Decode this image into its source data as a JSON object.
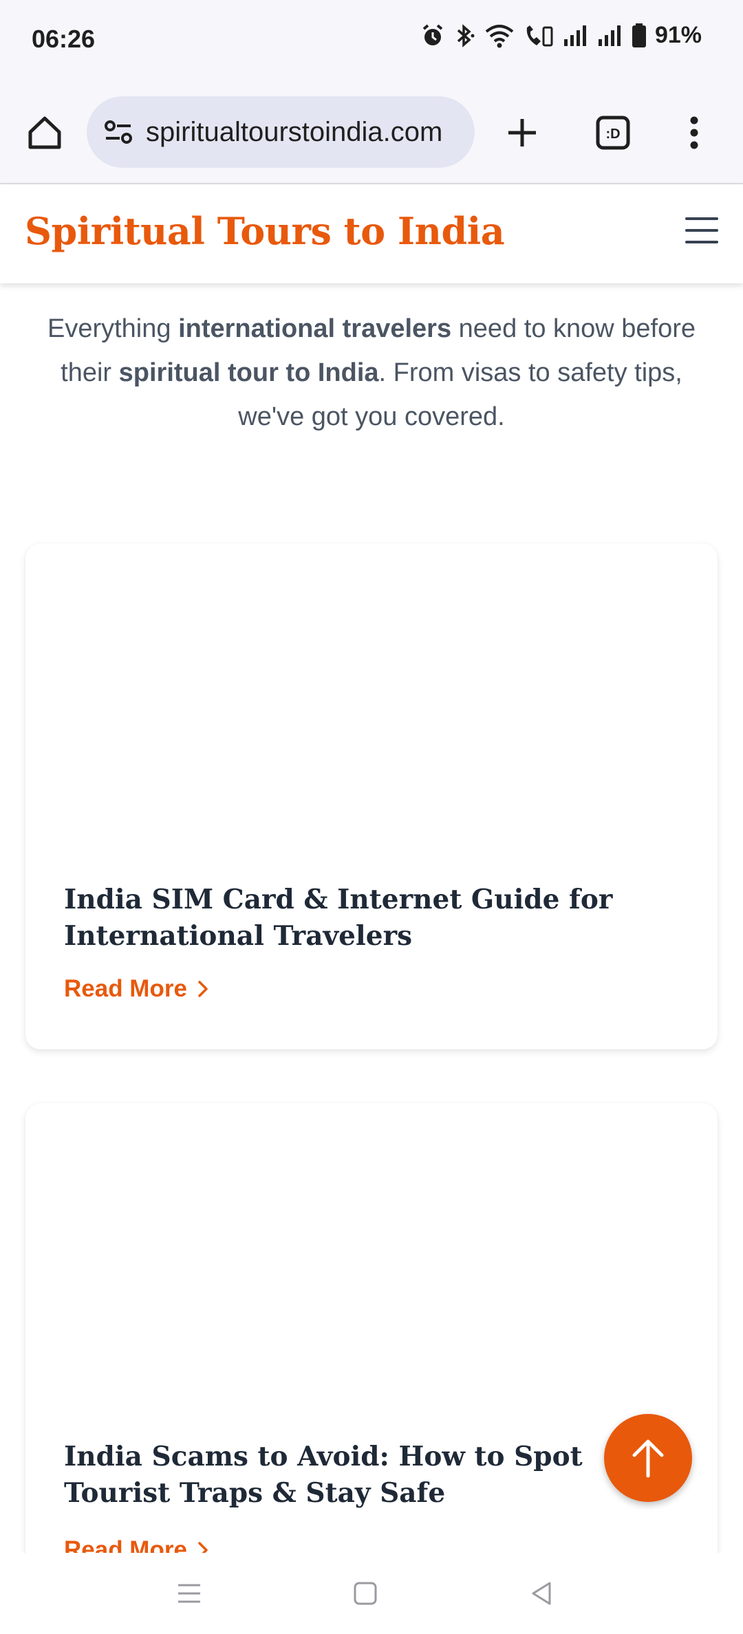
{
  "status_bar": {
    "time": "06:26",
    "battery_percent": "91%",
    "icons": [
      "alarm-icon",
      "bluetooth-icon",
      "wifi-icon",
      "wifi-calling-icon",
      "signal-icon",
      "signal-icon",
      "battery-icon"
    ]
  },
  "browser": {
    "url": "spiritualtourstoindia.com",
    "icons": [
      "home-icon",
      "site-info-icon",
      "new-tab-icon",
      "tab-switcher-icon",
      "more-vert-icon"
    ]
  },
  "site": {
    "title": "Spiritual Tours to India",
    "menu_icon": "hamburger-menu-icon"
  },
  "intro": {
    "part1": "Everything ",
    "bold1": "international travelers",
    "part2": " need to know before their ",
    "bold2": "spiritual tour to India",
    "part3": ". From visas to safety tips, we've got you covered."
  },
  "articles": [
    {
      "title": "India SIM Card & Internet Guide for International Travelers",
      "link": "Read More"
    },
    {
      "title": "India Scams to Avoid: How to Spot Tourist Traps & Stay Safe",
      "link": "Read More"
    }
  ],
  "fab": {
    "icon": "arrow-up-icon"
  },
  "nav": {
    "icons": [
      "recents-icon",
      "home-nav-icon",
      "back-icon"
    ]
  },
  "colors": {
    "accent": "#e8590c",
    "heading": "#1f2937",
    "body_text": "#4b5563"
  }
}
